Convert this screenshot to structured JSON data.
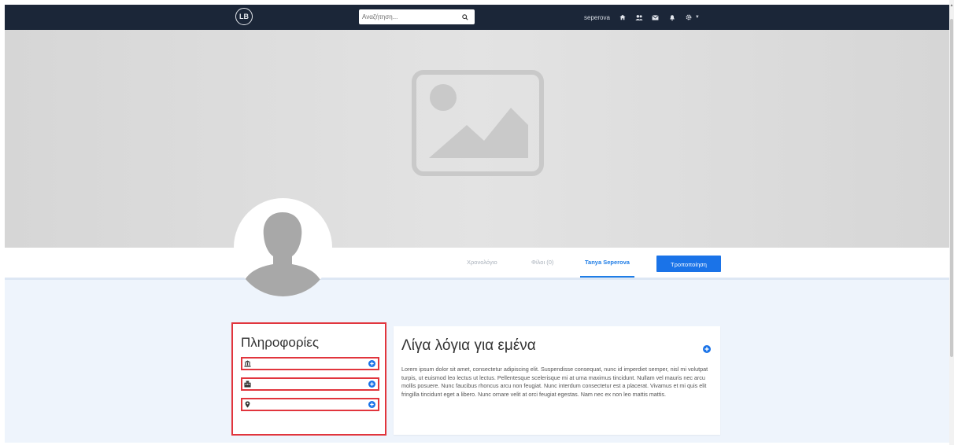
{
  "navbar": {
    "logo_text": "LB",
    "search": {
      "placeholder": "Αναζήτηση..."
    },
    "username": "seperova",
    "icons": [
      "home-icon",
      "friends-icon",
      "messages-icon",
      "notifications-icon",
      "settings-icon"
    ]
  },
  "profile": {
    "tabs": [
      {
        "label": "Χρονολόγιο"
      },
      {
        "label": "Φίλοι (0)"
      },
      {
        "label": "Tanya Seperova"
      }
    ],
    "edit_label": "Τροποποίηση"
  },
  "info": {
    "title": "Πληροφορίες",
    "rows": [
      {
        "icon": "institution-icon"
      },
      {
        "icon": "workplace-icon"
      },
      {
        "icon": "location-icon"
      }
    ]
  },
  "about": {
    "title": "Λίγα λόγια για εμένα",
    "text": "Lorem ipsum dolor sit amet, consectetur adipiscing elit. Suspendisse consequat, nunc id imperdiet semper, nisl mi volutpat turpis, ut euismod leo lectus ut lectus. Pellentesque scelerisque mi at urna maximus tincidunt. Nullam vel mauris nec arcu mollis posuere. Nunc faucibus rhoncus arcu non feugiat. Nunc interdum consectetur est a placerat. Vivamus et mi quis elit fringilla tincidunt eget a libero. Nunc ornare velit at orci feugiat egestas. Nam nec ex non leo mattis mattis."
  },
  "colors": {
    "navbar": "#1b2638",
    "accent": "#1a73e8",
    "highlight_border": "#e1353d",
    "page_background": "#eef4fc"
  }
}
